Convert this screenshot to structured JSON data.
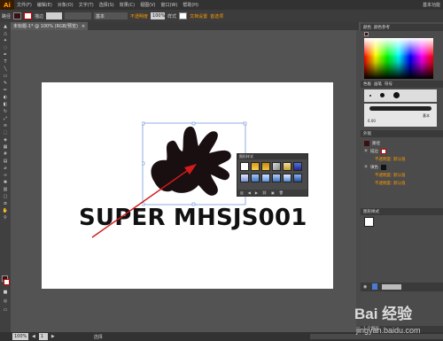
{
  "app": {
    "logo": "Ai",
    "menus": [
      "文件(F)",
      "编辑(E)",
      "对象(O)",
      "文字(T)",
      "选择(S)",
      "效果(C)",
      "视图(V)",
      "窗口(W)",
      "帮助(H)"
    ],
    "workspace": "基本功能"
  },
  "control": {
    "mode": "路径",
    "stroke_label": "描边",
    "weight_label": "基本",
    "opacity_label": "不透明度",
    "opacity": "100%",
    "style_label": "样式",
    "doc_setup": "文档设置",
    "prefs": "首选项"
  },
  "tab": {
    "title": "未标题-1* @ 100% (RGB/预览)",
    "close": "×"
  },
  "canvas": {
    "headline": "SUPER MHSJS001"
  },
  "graphic_styles": {
    "title": "图形样式"
  },
  "panels": {
    "color_title": "颜色",
    "color_ref_title": "颜色参考",
    "brushes_title": "画笔",
    "brush_tabs": [
      "色板",
      "画笔",
      "符号"
    ],
    "brush_size": "6.00",
    "brush_name": "基本",
    "appearance_title": "外观",
    "appearance_rows": [
      "路径",
      "描边",
      "不透明度: 默认值",
      "填色",
      "不透明度: 默认值",
      "不透明度: 默认值"
    ],
    "graphic_title": "图形样式",
    "layers_label": "1 个图层",
    "layers_title": "图层"
  },
  "status": {
    "zoom": "100%",
    "page": "1",
    "tool": "选择"
  },
  "watermark": {
    "brand": "Bai 经验",
    "site": "jingyan.baidu.com"
  },
  "colors": {
    "accent": "#ff9a00",
    "arrow": "#d11a1a",
    "selection": "#4a7bd0",
    "splat": "#1a0f10"
  }
}
